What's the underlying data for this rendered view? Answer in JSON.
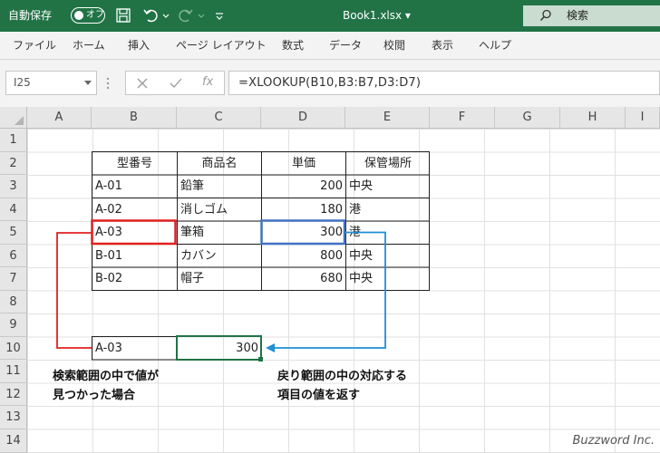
{
  "titlebar": {
    "autosave_label": "自動保存",
    "autosave_state": "オフ",
    "document_title": "Book1.xlsx ▾",
    "search_label": "検索",
    "accent_color": "#217346"
  },
  "menu": {
    "items": [
      "ファイル",
      "ホーム",
      "挿入",
      "ページ レイアウト",
      "数式",
      "データ",
      "校閲",
      "表示",
      "ヘルプ"
    ]
  },
  "formula_bar": {
    "cell_reference": "I25",
    "fx_label": "fx",
    "formula": "=XLOOKUP(B10,B3:B7,D3:D7)"
  },
  "columns": [
    "A",
    "B",
    "C",
    "D",
    "E",
    "F",
    "G",
    "H",
    "I"
  ],
  "rows": [
    "1",
    "2",
    "3",
    "4",
    "5",
    "6",
    "7",
    "8",
    "9",
    "10",
    "11",
    "12",
    "13",
    "14"
  ],
  "table": {
    "headers": [
      "型番号",
      "商品名",
      "単価",
      "保管場所"
    ],
    "rows": [
      [
        "A-01",
        "鉛筆",
        "200",
        "中央"
      ],
      [
        "A-02",
        "消しゴム",
        "180",
        "港"
      ],
      [
        "A-03",
        "筆箱",
        "300",
        "港"
      ],
      [
        "B-01",
        "カバン",
        "800",
        "中央"
      ],
      [
        "B-02",
        "帽子",
        "680",
        "中央"
      ]
    ]
  },
  "lookup": {
    "key": "A-03",
    "result": "300"
  },
  "annotations": {
    "left_line1": "検索範囲の中で値が",
    "left_line2": "見つかった場合",
    "right_line1": "戻り範囲の中の対応する",
    "right_line2": "項目の値を返す"
  },
  "colors": {
    "key_highlight": "#e02020",
    "value_highlight": "#4472c4",
    "arrow": "#1f8fd6"
  },
  "watermark": "Buzzword Inc."
}
